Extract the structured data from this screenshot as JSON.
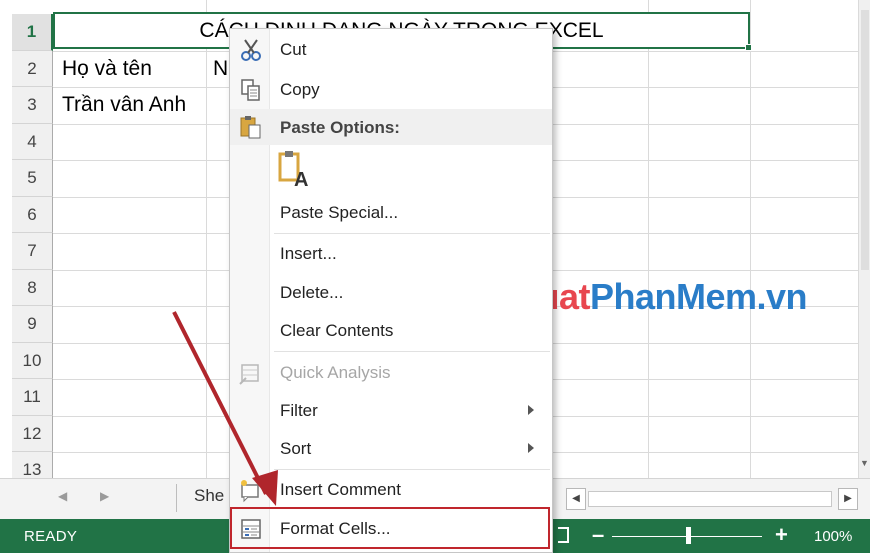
{
  "sheet": {
    "row_numbers": [
      "1",
      "2",
      "3",
      "4",
      "5",
      "6",
      "7",
      "8",
      "9",
      "10",
      "11",
      "12",
      "13"
    ],
    "title_cell": "CÁCH ĐỊNH DẠNG NGÀY TRONG EXCEL",
    "header_name": "Họ và tên",
    "header_next_partial": "N",
    "data_name": "Trần vân Anh"
  },
  "tabs": {
    "sheet_tab_partial": "She"
  },
  "status": {
    "text": "READY",
    "zoom_minus": "–",
    "zoom_plus": "+",
    "zoom_level": "100%"
  },
  "watermark": {
    "part_a": "ThuThuat",
    "part_b": "PhanMem.vn"
  },
  "context_menu": {
    "cut": "Cut",
    "copy": "Copy",
    "paste_options": "Paste Options:",
    "paste_special": "Paste Special...",
    "insert": "Insert...",
    "delete": "Delete...",
    "clear_contents": "Clear Contents",
    "quick_analysis": "Quick Analysis",
    "filter": "Filter",
    "sort": "Sort",
    "insert_comment": "Insert Comment",
    "format_cells": "Format Cells..."
  },
  "colors": {
    "excel_green": "#217346",
    "highlight_red": "#c0262d",
    "arrow_red": "#b0262c",
    "watermark_red": "#e8464f",
    "watermark_blue": "#2a7dc8"
  }
}
